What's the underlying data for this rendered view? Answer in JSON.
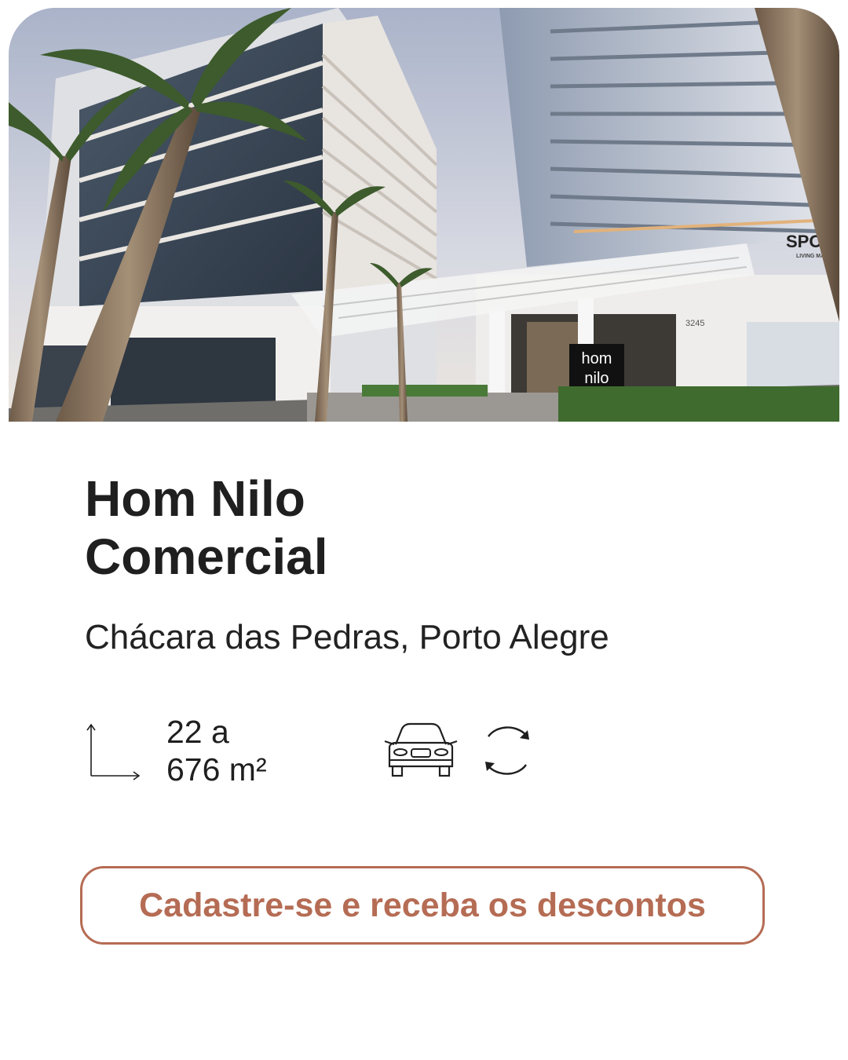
{
  "listing": {
    "title_line1": "Hom Nilo",
    "title_line2": "Comercial",
    "location": "Chácara das Pedras, Porto Alegre",
    "area_line1": "22 a",
    "area_line2": "676 m²",
    "cta_label": "Cadastre-se e receba os descontos"
  },
  "hero": {
    "sign_brand": "SPOT",
    "sign_subtitle": "LIVING MALL",
    "building_sign_line1": "hom",
    "building_sign_line2": "nilo",
    "street_number": "3245"
  },
  "icons": {
    "area": "area-dimension-icon",
    "parking": "car-icon",
    "rotating_parking": "rotate-arrows-icon"
  },
  "colors": {
    "accent": "#b56c54",
    "text": "#1f1f1f"
  }
}
